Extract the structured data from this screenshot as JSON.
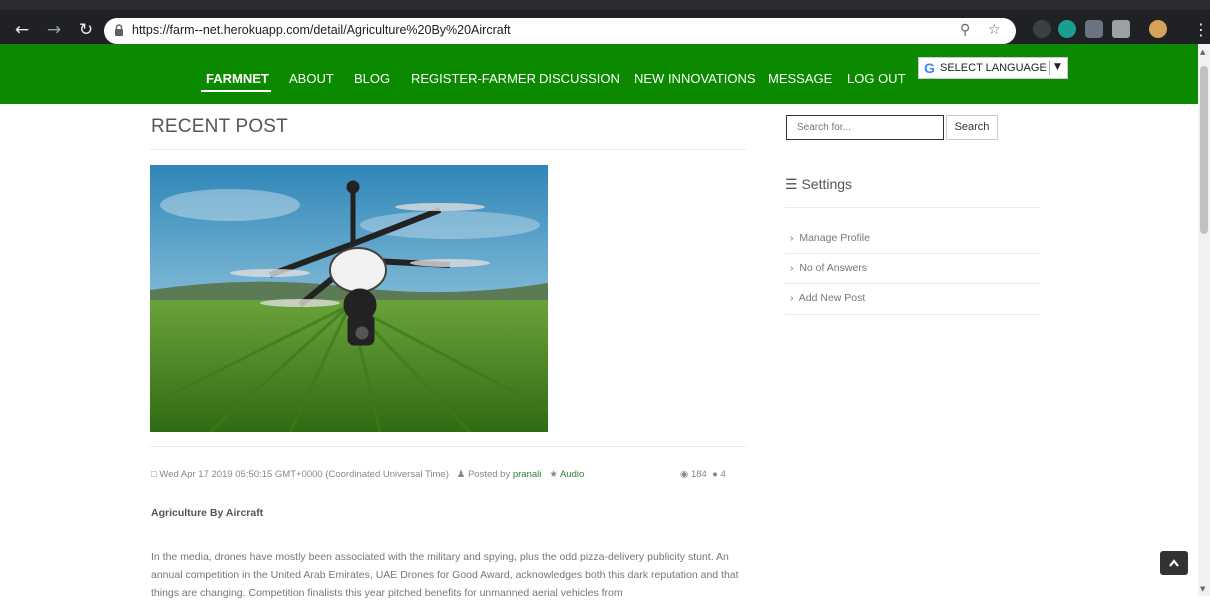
{
  "browser": {
    "url": "https://farm--net.herokuapp.com/detail/Agriculture%20By%20Aircraft",
    "icons": [
      "back-icon",
      "forward-icon",
      "reload-icon",
      "lock-icon",
      "zoom-icon",
      "star-icon",
      "menu-icon"
    ]
  },
  "navbar": {
    "items": [
      "FARMNET",
      "ABOUT",
      "BLOG",
      "REGISTER-FARMER",
      "DISCUSSION",
      "NEW INNOVATIONS",
      "MESSAGE",
      "LOG OUT"
    ],
    "language_label": "SELECT LANGUAGE",
    "color": "#0b8a00"
  },
  "main": {
    "section_title": "RECENT POST",
    "post": {
      "date": "Wed Apr 17 2019 05:50:15 GMT+0000 (Coordinated Universal Time)",
      "posted_by_label": "Posted by",
      "author": "pranali",
      "tag": "Audio",
      "views": "184",
      "comments": "4",
      "title": "Agriculture By Aircraft",
      "body": "In the media, drones have mostly been associated with the military and spying, plus the odd pizza-delivery publicity stunt. An annual competition in the United Arab Emirates, UAE Drones for Good Award, acknowledges both this dark reputation and that things are changing. Competition finalists this year pitched benefits for unmanned aerial vehicles from"
    }
  },
  "sidebar": {
    "search_placeholder": "Search for...",
    "search_button": "Search",
    "settings_title": "Settings",
    "items": [
      "Manage Profile",
      "No of Answers",
      "Add New Post"
    ]
  }
}
